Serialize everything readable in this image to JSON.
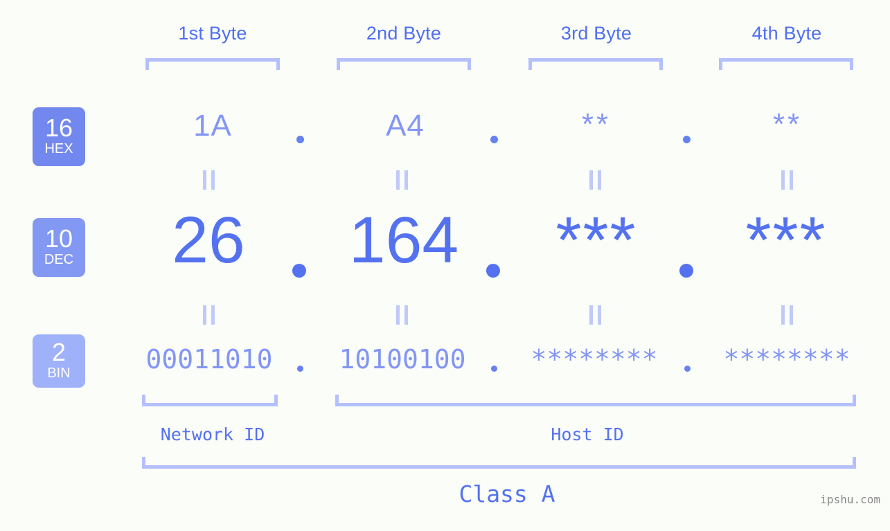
{
  "colors": {
    "background": "#fbfdf8",
    "accent_strong": "#5472f0",
    "accent_mid": "#8396f4",
    "accent_light": "#b4c0fb",
    "badge_hex": "#7388ee",
    "badge_dec": "#8398f3",
    "badge_bin": "#9fb1f9"
  },
  "headers": {
    "bytes": [
      {
        "label": "1st Byte"
      },
      {
        "label": "2nd Byte"
      },
      {
        "label": "3rd Byte"
      },
      {
        "label": "4th Byte"
      }
    ]
  },
  "bases": [
    {
      "number": "16",
      "name": "HEX"
    },
    {
      "number": "10",
      "name": "DEC"
    },
    {
      "number": "2",
      "name": "BIN"
    }
  ],
  "rows": {
    "hex": {
      "values": [
        "1A",
        "A4",
        "**",
        "**"
      ],
      "separator": "."
    },
    "dec": {
      "values": [
        "26",
        "164",
        "***",
        "***"
      ],
      "separator": "."
    },
    "bin": {
      "values": [
        "00011010",
        "10100100",
        "********",
        "********"
      ],
      "separator": "."
    }
  },
  "equals_symbol": "||",
  "segments": {
    "network_id": "Network ID",
    "host_id": "Host ID",
    "class": "Class A"
  },
  "watermark": "ipshu.com"
}
